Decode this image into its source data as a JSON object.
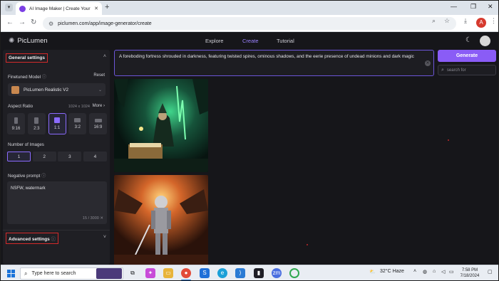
{
  "browser": {
    "tab_title": "AI Image Maker | Create Your F",
    "url": "piclumen.com/app/image-generator/create",
    "account_initial": "A"
  },
  "app": {
    "brand": "PicLumen",
    "nav": {
      "explore": "Explore",
      "create": "Create",
      "tutorial": "Tutorial"
    }
  },
  "sidebar": {
    "general_settings": "General settings",
    "finetuned_model_label": "Finetuned Model",
    "reset": "Reset",
    "model_name": "PicLumen Realistic V2",
    "aspect_ratio_label": "Aspect Ratio",
    "aspect_dimensions": "1024 x 1024",
    "more": "More",
    "ratios": [
      "9:16",
      "2:3",
      "1:1",
      "3:2",
      "16:9"
    ],
    "selected_ratio": "1:1",
    "number_of_images_label": "Number of Images",
    "counts": [
      "1",
      "2",
      "3",
      "4"
    ],
    "selected_count": "1",
    "negative_prompt_label": "Negative prompt",
    "negative_prompt_value": "NSFW, watermark",
    "char_count": "15 / 3000",
    "advanced_settings": "Advanced settings"
  },
  "prompt": {
    "text": "A foreboding fortress shrouded in darkness, featuring twisted spires, ominous shadows, and the eerie presence of undead minions and dark magic"
  },
  "generate_button": "Generate",
  "search": {
    "placeholder": "search for"
  },
  "taskbar": {
    "search_placeholder": "Type here to search",
    "weather": "32°C  Haze",
    "time": "7:58 PM",
    "date": "7/18/2024"
  },
  "colors": {
    "accent": "#8a5cf6",
    "highlight_box": "#d42a2a",
    "app_bg": "#16161a"
  }
}
